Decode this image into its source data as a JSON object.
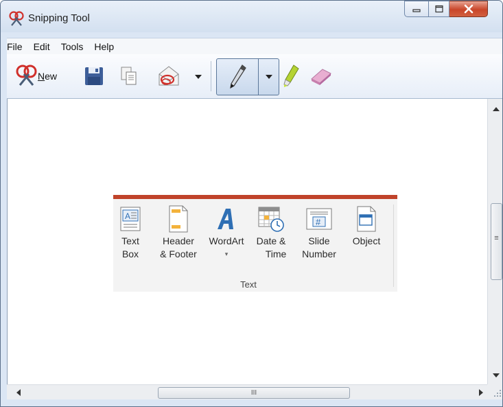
{
  "window": {
    "title": "Snipping Tool",
    "accent": "#c0432a"
  },
  "menu": {
    "items": [
      "File",
      "Edit",
      "Tools",
      "Help"
    ]
  },
  "toolbar": {
    "new_label": "New",
    "new_mnemonic": "N",
    "new_rest": "ew"
  },
  "snip": {
    "buttons": [
      {
        "line1": "Text",
        "line2": "Box",
        "icon": "text-box-icon"
      },
      {
        "line1": "Header",
        "line2": "& Footer",
        "icon": "header-footer-icon"
      },
      {
        "line1": "WordArt",
        "line2": "▾",
        "icon": "wordart-icon"
      },
      {
        "line1": "Date &",
        "line2": "Time",
        "icon": "date-time-icon"
      },
      {
        "line1": "Slide",
        "line2": "Number",
        "icon": "slide-number-icon"
      },
      {
        "line1": "Object",
        "line2": "",
        "icon": "object-icon"
      }
    ],
    "group_label": "Text"
  },
  "scrollbar": {
    "h_thumb_grip": "III",
    "v_thumb_grip": "≡"
  }
}
